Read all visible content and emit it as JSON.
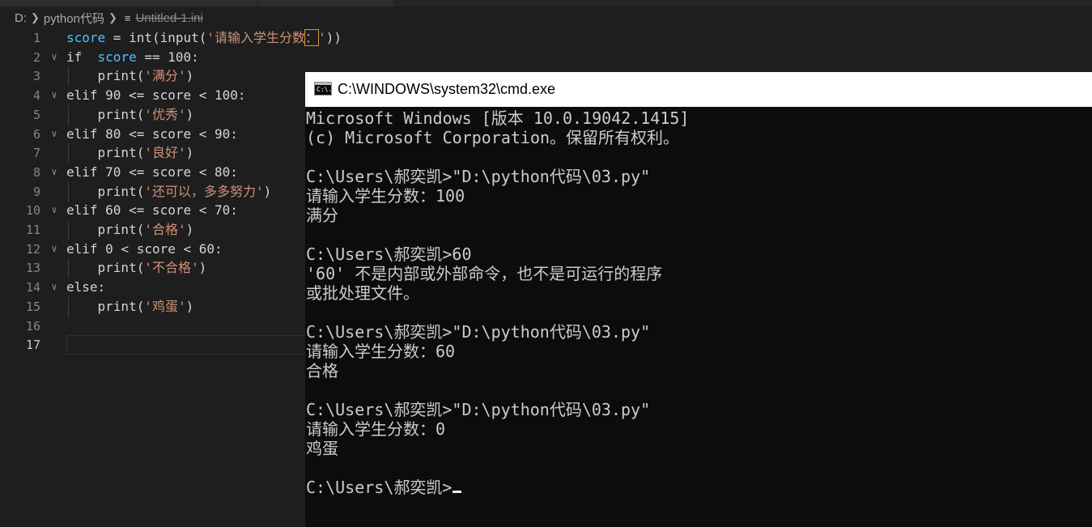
{
  "breadcrumb": {
    "drive": "D:",
    "folder": "python代码",
    "file": "Untitled-1.ini"
  },
  "editor": {
    "active_line": 17,
    "lines": [
      {
        "n": "1",
        "parts": [
          [
            "var",
            "score"
          ],
          [
            "txt",
            " = int(input("
          ],
          [
            "str",
            "'请输入学生分数"
          ],
          [
            "strbox",
            "："
          ],
          [
            "str",
            "'"
          ],
          [
            "txt",
            "))"
          ]
        ]
      },
      {
        "n": "2",
        "parts": [
          [
            "kw",
            "if  "
          ],
          [
            "var",
            "score"
          ],
          [
            "txt",
            " == 100:"
          ]
        ]
      },
      {
        "n": "3",
        "parts": [
          [
            "txt",
            "    print("
          ],
          [
            "str",
            "'满分'"
          ],
          [
            "txt",
            ")"
          ]
        ]
      },
      {
        "n": "4",
        "parts": [
          [
            "kw",
            "elif"
          ],
          [
            "txt",
            " 90 <= score < 100:"
          ]
        ]
      },
      {
        "n": "5",
        "parts": [
          [
            "txt",
            "    print("
          ],
          [
            "str",
            "'优秀'"
          ],
          [
            "txt",
            ")"
          ]
        ]
      },
      {
        "n": "6",
        "parts": [
          [
            "kw",
            "elif"
          ],
          [
            "txt",
            " 80 <= score < 90:"
          ]
        ]
      },
      {
        "n": "7",
        "parts": [
          [
            "txt",
            "    print("
          ],
          [
            "str",
            "'良好'"
          ],
          [
            "txt",
            ")"
          ]
        ]
      },
      {
        "n": "8",
        "parts": [
          [
            "kw",
            "elif"
          ],
          [
            "txt",
            " 70 <= score < 80:"
          ]
        ]
      },
      {
        "n": "9",
        "parts": [
          [
            "txt",
            "    print("
          ],
          [
            "str",
            "'还可以，多多努力'"
          ],
          [
            "txt",
            ")"
          ]
        ]
      },
      {
        "n": "10",
        "parts": [
          [
            "kw",
            "elif"
          ],
          [
            "txt",
            " 60 <= score < 70:"
          ]
        ]
      },
      {
        "n": "11",
        "parts": [
          [
            "txt",
            "    print("
          ],
          [
            "str",
            "'合格'"
          ],
          [
            "txt",
            ")"
          ]
        ]
      },
      {
        "n": "12",
        "parts": [
          [
            "kw",
            "elif"
          ],
          [
            "txt",
            " 0 < score < 60:"
          ]
        ]
      },
      {
        "n": "13",
        "parts": [
          [
            "txt",
            "    print("
          ],
          [
            "str",
            "'不合格'"
          ],
          [
            "txt",
            ")"
          ]
        ]
      },
      {
        "n": "14",
        "parts": [
          [
            "kw",
            "else"
          ],
          [
            "txt",
            ":"
          ]
        ]
      },
      {
        "n": "15",
        "parts": [
          [
            "txt",
            "    print("
          ],
          [
            "str",
            "'鸡蛋'"
          ],
          [
            "txt",
            ")"
          ]
        ]
      },
      {
        "n": "16",
        "parts": []
      },
      {
        "n": "17",
        "parts": []
      }
    ]
  },
  "cmd": {
    "title": "C:\\WINDOWS\\system32\\cmd.exe",
    "icon_text": "C:\\.",
    "lines": [
      "Microsoft Windows [版本 10.0.19042.1415]",
      "(c) Microsoft Corporation。保留所有权利。",
      "",
      "C:\\Users\\郝奕凯>\"D:\\python代码\\03.py\"",
      "请输入学生分数：100",
      "满分",
      "",
      "C:\\Users\\郝奕凯>60",
      "'60' 不是内部或外部命令，也不是可运行的程序",
      "或批处理文件。",
      "",
      "C:\\Users\\郝奕凯>\"D:\\python代码\\03.py\"",
      "请输入学生分数：60",
      "合格",
      "",
      "C:\\Users\\郝奕凯>\"D:\\python代码\\03.py\"",
      "请输入学生分数：0",
      "鸡蛋",
      "",
      "C:\\Users\\郝奕凯>"
    ]
  }
}
